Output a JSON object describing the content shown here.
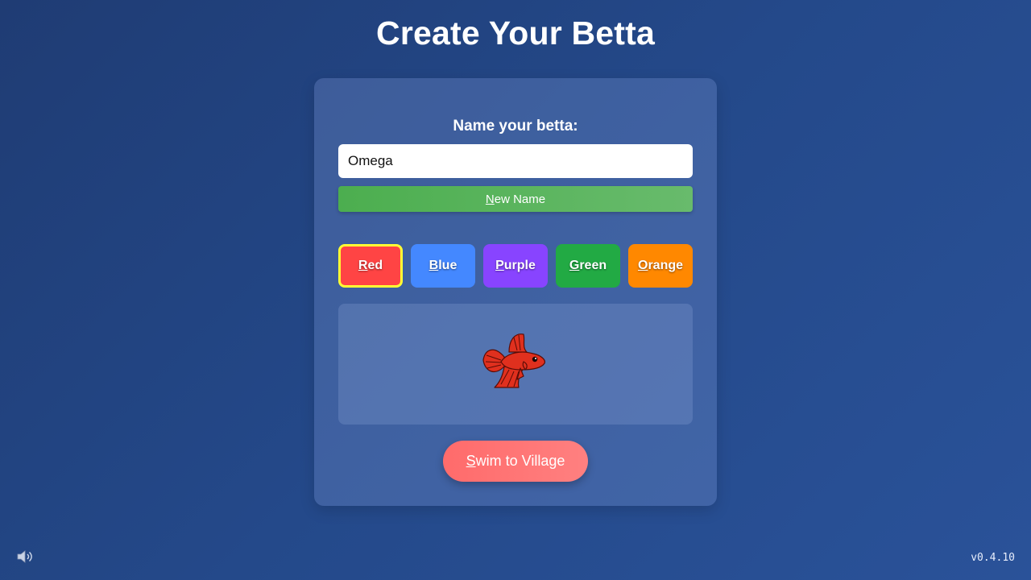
{
  "page": {
    "title": "Create Your Betta"
  },
  "name_section": {
    "label": "Name your betta:",
    "input_value": "Omega",
    "new_name_button": {
      "hotkey": "N",
      "rest": "ew Name"
    }
  },
  "colors": {
    "selected": "Red",
    "options": [
      {
        "hotkey": "R",
        "rest": "ed",
        "color": "#ff4444"
      },
      {
        "hotkey": "B",
        "rest": "lue",
        "color": "#4488ff"
      },
      {
        "hotkey": "P",
        "rest": "urple",
        "color": "#8844ff"
      },
      {
        "hotkey": "G",
        "rest": "reen",
        "color": "#22aa44"
      },
      {
        "hotkey": "O",
        "rest": "range",
        "color": "#ff8800"
      }
    ]
  },
  "preview": {
    "fish_icon": "betta-fish-icon",
    "fish_color": "#e0301e"
  },
  "swim_button": {
    "hotkey": "S",
    "rest": "wim to Village"
  },
  "footer": {
    "sound_icon": "speaker-icon",
    "version": "v0.4.10"
  }
}
